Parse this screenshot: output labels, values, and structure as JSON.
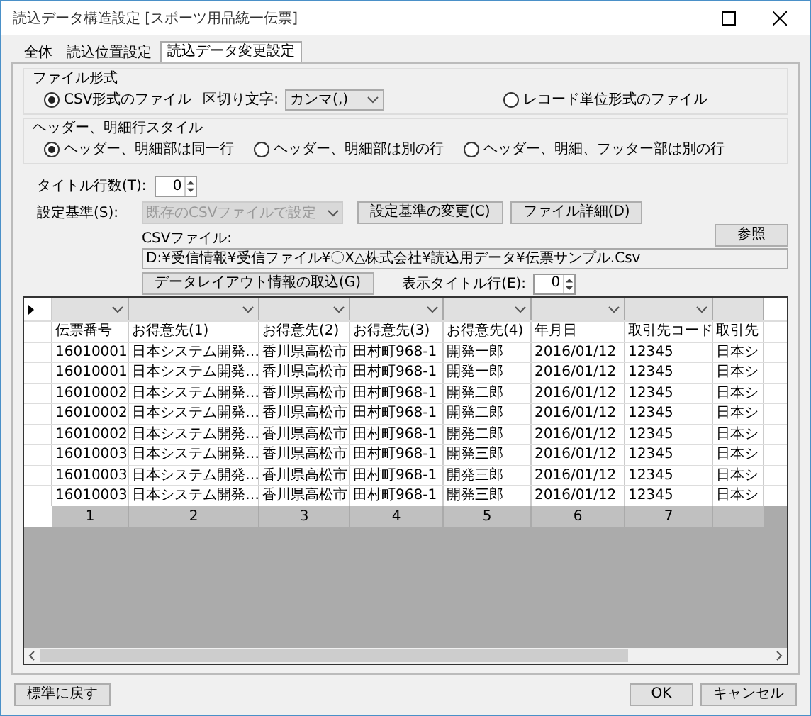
{
  "window": {
    "title": "読込データ構造設定 [スポーツ用品統一伝票]"
  },
  "tabs": [
    {
      "label": "全体",
      "selected": false
    },
    {
      "label": "読込位置設定",
      "selected": false
    },
    {
      "label": "読込データ変更設定",
      "selected": true
    }
  ],
  "file_format": {
    "title": "ファイル形式",
    "options": [
      {
        "label": "CSV形式のファイル",
        "selected": true
      },
      {
        "label": "レコード単位形式のファイル",
        "selected": false
      }
    ],
    "delimiter": {
      "label": "区切り文字:",
      "value": "カンマ(,)"
    }
  },
  "row_style": {
    "title": "ヘッダー、明細行スタイル",
    "options": [
      {
        "label": "ヘッダー、明細部は同一行",
        "selected": true
      },
      {
        "label": "ヘッダー、明細部は別の行",
        "selected": false
      },
      {
        "label": "ヘッダー、明細、フッター部は別の行",
        "selected": false
      }
    ]
  },
  "title_rows": {
    "label": "タイトル行数(T):",
    "value": "0"
  },
  "basis": {
    "label": "設定基準(S):",
    "value": "既存のCSVファイルで設定",
    "disabled": true
  },
  "basis_buttons": [
    "設定基準の変更(C)",
    "ファイル詳細(D)"
  ],
  "csv_file": {
    "label": "CSVファイル:",
    "value": "D:¥受信情報¥受信ファイル¥〇X△株式会社¥読込用データ¥伝票サンプル.Csv",
    "browse": "参照"
  },
  "layout_button": "データレイアウト情報の取込(G)",
  "display_title_row": {
    "label": "表示タイトル行(E):",
    "value": "0"
  },
  "grid": {
    "rows": [
      [
        "伝票番号",
        "お得意先(1)",
        "お得意先(2)",
        "お得意先(3)",
        "お得意先(4)",
        "年月日",
        "取引先コード",
        "取引先"
      ],
      [
        "16010001",
        "日本システム開発…",
        "香川県高松市",
        "田村町968-1",
        "開発一郎",
        "2016/01/12",
        "12345",
        "日本シ"
      ],
      [
        "16010001",
        "日本システム開発…",
        "香川県高松市",
        "田村町968-1",
        "開発一郎",
        "2016/01/12",
        "12345",
        "日本シ"
      ],
      [
        "16010002",
        "日本システム開発…",
        "香川県高松市",
        "田村町968-1",
        "開発二郎",
        "2016/01/12",
        "12345",
        "日本シ"
      ],
      [
        "16010002",
        "日本システム開発…",
        "香川県高松市",
        "田村町968-1",
        "開発二郎",
        "2016/01/12",
        "12345",
        "日本シ"
      ],
      [
        "16010002",
        "日本システム開発…",
        "香川県高松市",
        "田村町968-1",
        "開発二郎",
        "2016/01/12",
        "12345",
        "日本シ"
      ],
      [
        "16010003",
        "日本システム開発…",
        "香川県高松市",
        "田村町968-1",
        "開発三郎",
        "2016/01/12",
        "12345",
        "日本シ"
      ],
      [
        "16010003",
        "日本システム開発…",
        "香川県高松市",
        "田村町968-1",
        "開発三郎",
        "2016/01/12",
        "12345",
        "日本シ"
      ],
      [
        "16010003",
        "日本システム開発…",
        "香川県高松市",
        "田村町968-1",
        "開発三郎",
        "2016/01/12",
        "12345",
        "日本シ"
      ]
    ],
    "column_numbers": [
      "1",
      "2",
      "3",
      "4",
      "5",
      "6",
      "7"
    ]
  },
  "footer": {
    "reset": "標準に戻す",
    "ok": "OK",
    "cancel": "キャンセル"
  }
}
